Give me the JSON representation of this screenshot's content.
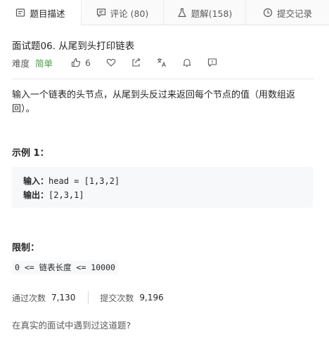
{
  "tabs": [
    {
      "label": "题目描述",
      "icon": "document-icon",
      "active": true
    },
    {
      "label": "评论 (80)",
      "icon": "comment-icon",
      "active": false
    },
    {
      "label": "题解(158)",
      "icon": "flask-icon",
      "active": false
    },
    {
      "label": "提交记录",
      "icon": "clock-icon",
      "active": false
    }
  ],
  "problem": {
    "title": "面试题06. 从尾到头打印链表",
    "difficulty_label": "难度",
    "difficulty": "简单",
    "difficulty_color": "#43a047",
    "likes": "6"
  },
  "description": "输入一个链表的头节点，从尾到头反过来返回每个节点的值（用数组返回）。",
  "example": {
    "title": "示例 1：",
    "input_label": "输入：",
    "input_value": "head = [1,3,2]",
    "output_label": "输出：",
    "output_value": "[2,3,1]"
  },
  "limits": {
    "title": "限制：",
    "text": "0 <= 链表长度 <= 10000"
  },
  "stats": {
    "accepted_label": "通过次数",
    "accepted_value": "7,130",
    "submitted_label": "提交次数",
    "submitted_value": "9,196"
  },
  "question": "在真实的面试中遇到过这道题?"
}
